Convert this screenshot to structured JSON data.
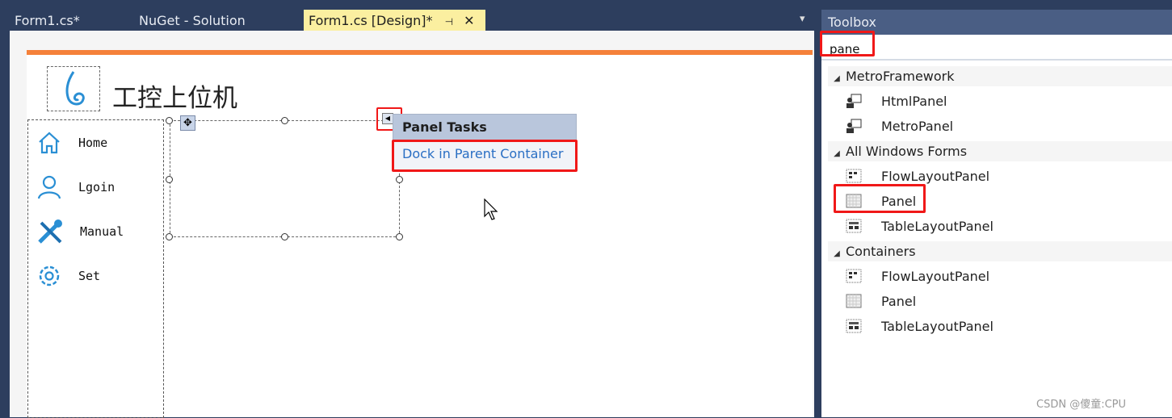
{
  "tabs": [
    {
      "label": "Form1.cs*"
    },
    {
      "label": "NuGet - Solution"
    },
    {
      "label": "Form1.cs [Design]*",
      "active": true,
      "pin": "⊣",
      "close": "✕"
    }
  ],
  "tab_overflow_icon": "▾",
  "form": {
    "title": "工控上位机",
    "nav": [
      {
        "label": "Home",
        "icon": "home-icon"
      },
      {
        "label": "Lgoin",
        "icon": "user-icon"
      },
      {
        "label": "Manual",
        "icon": "tools-icon"
      },
      {
        "label": "Set",
        "icon": "gear-icon"
      }
    ],
    "accent": "#f5813a"
  },
  "smart_tag": {
    "header": "Panel Tasks",
    "action": "Dock in Parent Container"
  },
  "toolbox": {
    "title": "Toolbox",
    "search_value": "pane",
    "groups": [
      {
        "name": "MetroFramework",
        "items": [
          "HtmlPanel",
          "MetroPanel"
        ]
      },
      {
        "name": "All Windows Forms",
        "items": [
          "FlowLayoutPanel",
          "Panel",
          "TableLayoutPanel"
        ]
      },
      {
        "name": "Containers",
        "items": [
          "FlowLayoutPanel",
          "Panel",
          "TableLayoutPanel"
        ]
      }
    ]
  },
  "watermark": "CSDN @傻童:CPU",
  "colors": {
    "highlight": "#f01818",
    "link": "#2a6fc4",
    "chrome": "#2d3e5e"
  }
}
